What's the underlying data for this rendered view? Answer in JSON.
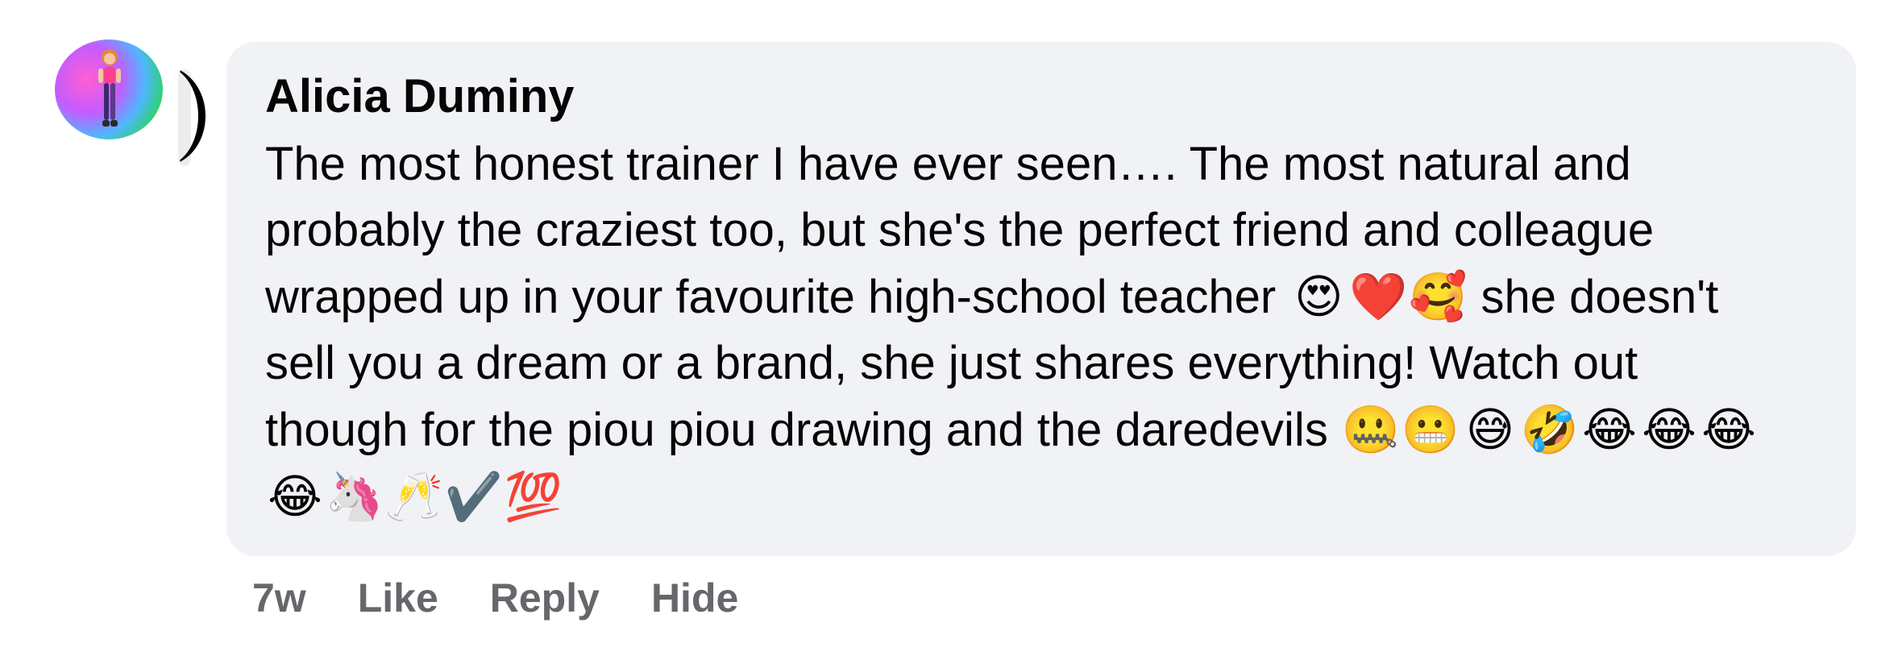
{
  "comment": {
    "author": "Alicia Duminy",
    "text_lines": [
      "The most honest trainer I have ever seen…. The most natural and",
      "probably the craziest too, but she's the perfect friend and colleague",
      "wrapped up in your favourite high-school teacher",
      "she doesn't",
      "sell you a dream or a brand, she just shares everything! Watch out",
      "though for the piou piou drawing and the daredevils"
    ],
    "emojis_line3": [
      "😍",
      "❤️",
      "🥰"
    ],
    "emojis_line5": [
      "🤐",
      "😬",
      "😅",
      "🤣",
      "😂",
      "😂",
      "😂"
    ],
    "emojis_line6": [
      "😂",
      "🦄",
      "🥂",
      "✔️",
      "💯"
    ],
    "bubble_color": "#f0f2f5",
    "text_color": "#050505"
  },
  "actions": {
    "timestamp": "7w",
    "like_label": "Like",
    "reply_label": "Reply",
    "hide_label": "Hide",
    "color": "#65676b"
  }
}
